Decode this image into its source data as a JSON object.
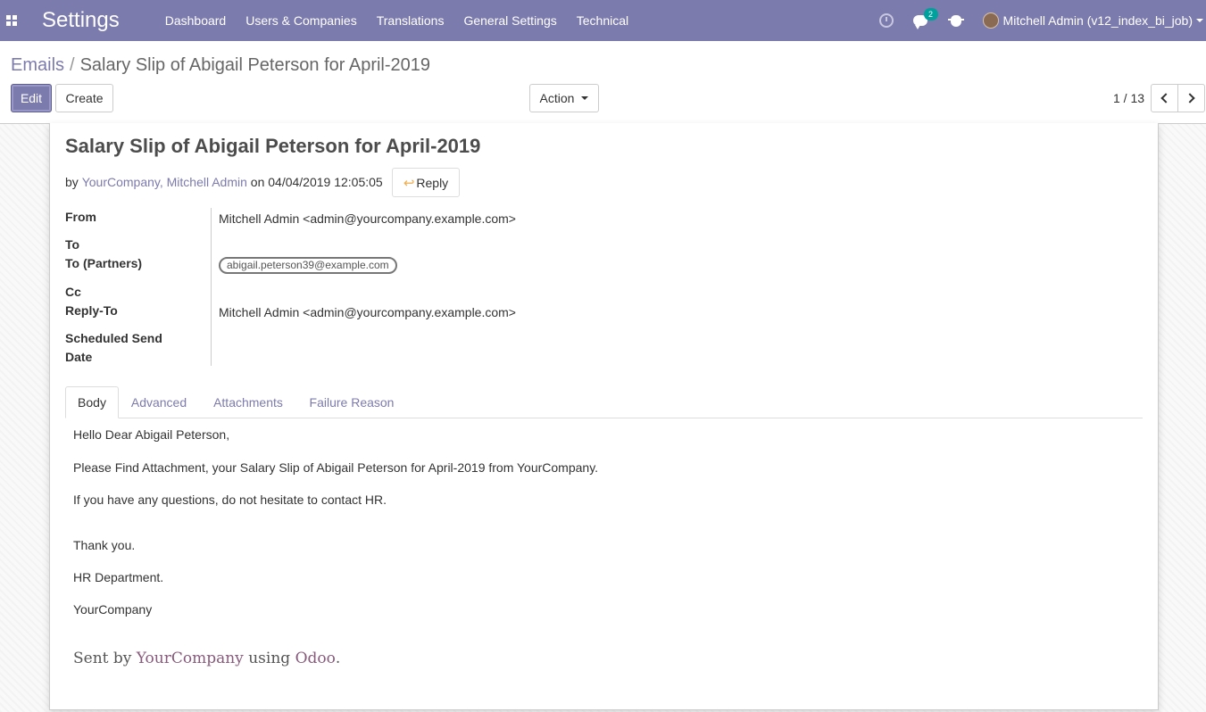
{
  "navbar": {
    "brand": "Settings",
    "menu": [
      "Dashboard",
      "Users & Companies",
      "Translations",
      "General Settings",
      "Technical"
    ],
    "chat_count": "2",
    "user": "Mitchell Admin (v12_index_bi_job)"
  },
  "breadcrumb": {
    "parent": "Emails",
    "separator": "/",
    "current": "Salary Slip of Abigail Peterson for April-2019"
  },
  "toolbar": {
    "edit": "Edit",
    "create": "Create",
    "action": "Action",
    "pager": "1 / 13"
  },
  "message": {
    "subject": "Salary Slip of Abigail Peterson for April-2019",
    "by_prefix": "by",
    "authors": "YourCompany, Mitchell Admin",
    "on_text": "on",
    "date": "04/04/2019 12:05:05",
    "reply": "Reply"
  },
  "fields": {
    "from_label": "From",
    "from_value": "Mitchell Admin <admin@yourcompany.example.com>",
    "to_label": "To",
    "to_partners_label": "To (Partners)",
    "to_partners_tag": "abigail.peterson39@example.com",
    "cc_label": "Cc",
    "reply_to_label": "Reply-To",
    "reply_to_value": "Mitchell Admin <admin@yourcompany.example.com>",
    "scheduled_label_1": "Scheduled Send",
    "scheduled_label_2": "Date"
  },
  "tabs": [
    "Body",
    "Advanced",
    "Attachments",
    "Failure Reason"
  ],
  "body": {
    "greeting": "Hello Dear Abigail Peterson,",
    "line1": "Please Find Attachment, your Salary Slip of Abigail Peterson for April-2019 from YourCompany.",
    "line2": "If you have any questions, do not hesitate to contact HR.",
    "thanks": "Thank you.",
    "dept": "HR Department.",
    "company": "YourCompany",
    "sent_prefix": "Sent by",
    "sent_company": "YourCompany",
    "sent_using": "using",
    "sent_odoo": "Odoo",
    "sent_suffix": "."
  },
  "colors": {
    "navbar": "#7c7bad",
    "link": "#7c7bad",
    "badge": "#00a09d",
    "odoo_brand": "#875a7b"
  }
}
